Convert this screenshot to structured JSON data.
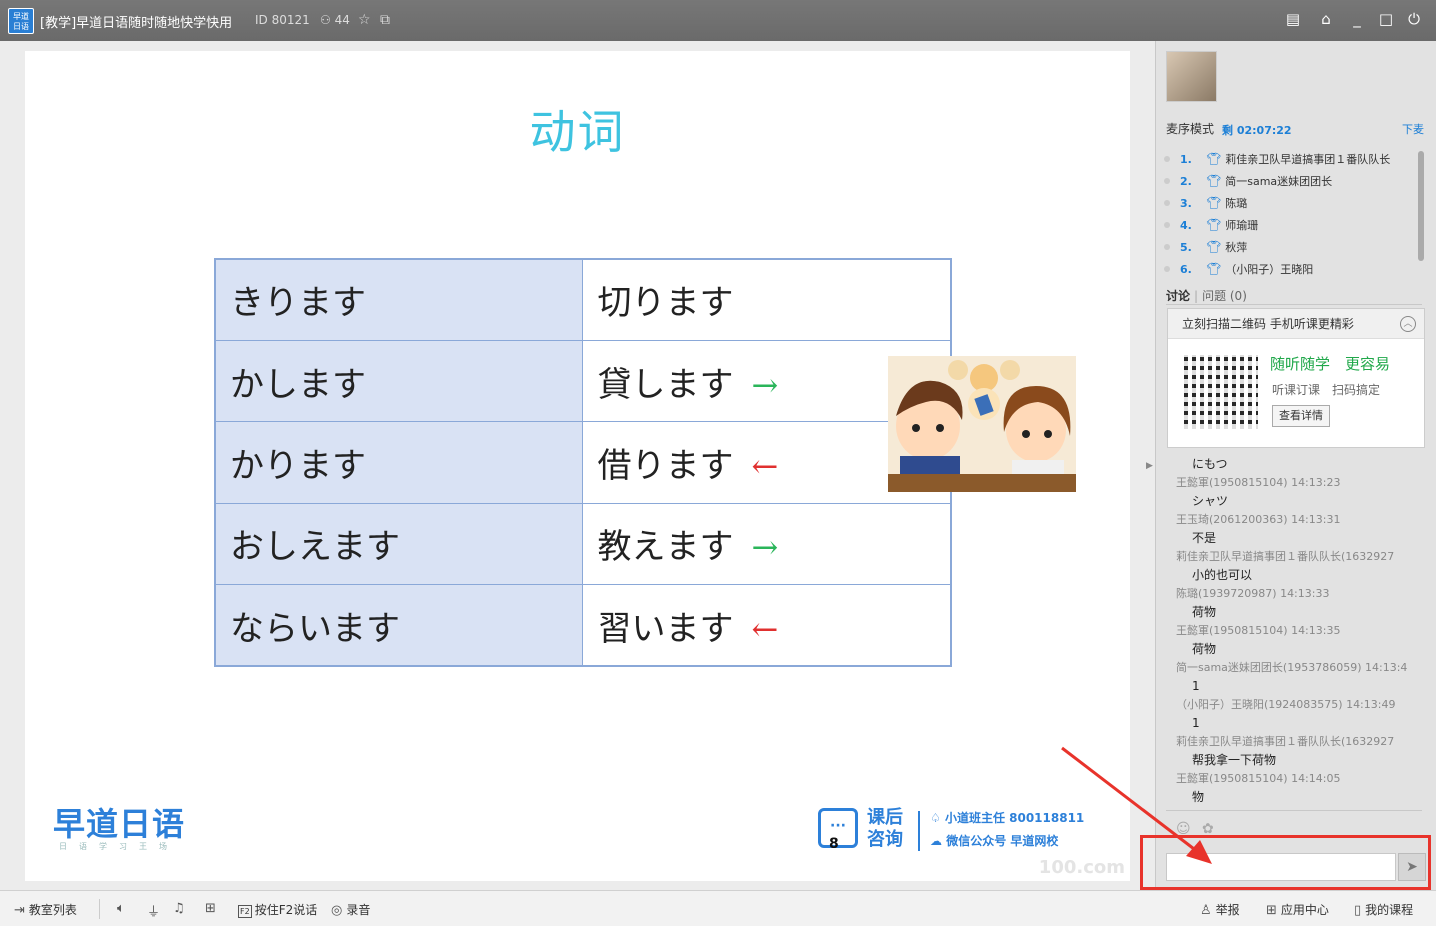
{
  "window": {
    "logo_text": "早道 日语",
    "title": "[教学]早道日语随时随地快学快用",
    "id_text": "ID 80121",
    "user_count": "44"
  },
  "slide": {
    "title": "动词",
    "rows": [
      {
        "left": "きります",
        "right": "切ります",
        "arrow": ""
      },
      {
        "left": "かします",
        "right": "貸します",
        "arrow": "→",
        "arrow_color": "#2ab55a"
      },
      {
        "left": "かります",
        "right": "借ります",
        "arrow": "←",
        "arrow_color": "#e0302f"
      },
      {
        "left": "おしえます",
        "right": "教えます",
        "arrow": "→",
        "arrow_color": "#2ab55a"
      },
      {
        "left": "ならいます",
        "right": "習います",
        "arrow": "←",
        "arrow_color": "#e0302f"
      }
    ],
    "brand": "早道日语",
    "brand_sub": "日语学习王场",
    "consult_top": "课后",
    "consult_bottom": "咨询",
    "consult_badge": "8",
    "line1": "小道班主任 800118811",
    "line2": "微信公众号 早道网校",
    "watermark": "100.com"
  },
  "panel": {
    "mode_label": "麦序模式",
    "remaining": "剩 02:07:22",
    "leave_mic": "下麦",
    "queue": [
      {
        "num": "1.",
        "name": "莉佳亲卫队早道搞事团１番队队长"
      },
      {
        "num": "2.",
        "name": "简一sama迷妹团团长"
      },
      {
        "num": "3.",
        "name": "陈璐"
      },
      {
        "num": "4.",
        "name": "师瑜珊"
      },
      {
        "num": "5.",
        "name": "秋萍"
      },
      {
        "num": "6.",
        "name": "（小阳子）王晓阳"
      }
    ],
    "tab_discuss": "讨论",
    "tab_question": "问题 (0)",
    "qr_header": "立刻扫描二维码 手机听课更精彩",
    "qr_slogan": "随听随学　更容易",
    "qr_sub": "听课订课　扫码搞定",
    "qr_button": "查看详情",
    "chat": [
      {
        "text": "にもつ",
        "who": "王懿軍(1950815104) 14:13:23"
      },
      {
        "text": "シャツ",
        "who": "王玉琦(2061200363) 14:13:31"
      },
      {
        "text": "不是",
        "who": "莉佳亲卫队早道搞事团１番队队长(1632927"
      },
      {
        "text": "小的也可以",
        "who": "陈璐(1939720987) 14:13:33"
      },
      {
        "text": "荷物",
        "who": "王懿軍(1950815104) 14:13:35"
      },
      {
        "text": "荷物",
        "who": "简一sama迷妹团团长(1953786059) 14:13:4"
      },
      {
        "text": "1",
        "who": "（小阳子）王晓阳(1924083575) 14:13:49"
      },
      {
        "text": "1",
        "who": "莉佳亲卫队早道搞事团１番队队长(1632927"
      },
      {
        "text": "帮我拿一下荷物",
        "who": "王懿軍(1950815104) 14:14:05"
      },
      {
        "text": "物",
        "who": ""
      }
    ],
    "input_placeholder": ""
  },
  "bottombar": {
    "classroom_list": "教室列表",
    "push_to_talk": "按住F2说话",
    "f2": "F2",
    "record": "录音",
    "report": "举报",
    "app_center": "应用中心",
    "my_courses": "我的课程"
  },
  "colors": {
    "accent_blue": "#1c7fd6",
    "annotation_red": "#e8332b",
    "title_cyan": "#3ec3e0",
    "table_fill": "#d9e2f4"
  }
}
